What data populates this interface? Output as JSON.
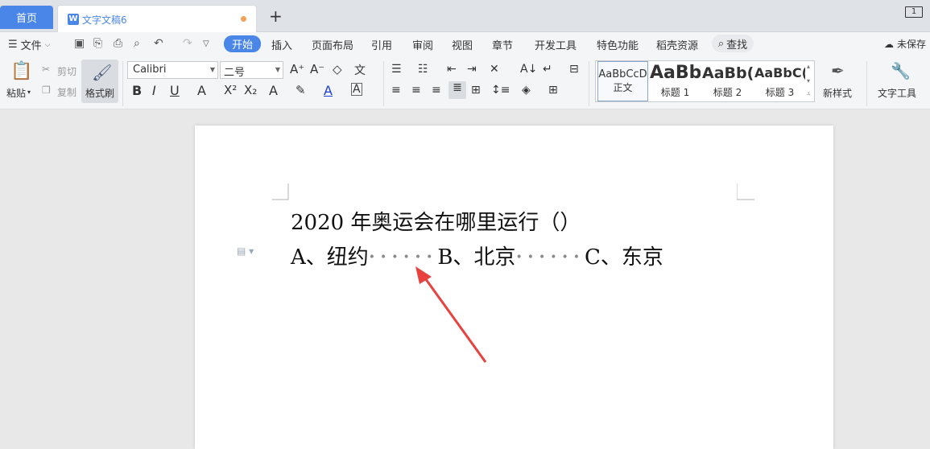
{
  "tabs": {
    "home": "首页",
    "document": "文字文稿6",
    "add": "+",
    "window_count": "1"
  },
  "menu": {
    "file": "文件",
    "items": [
      "开始",
      "插入",
      "页面布局",
      "引用",
      "审阅",
      "视图",
      "章节",
      "开发工具",
      "特色功能",
      "稻壳资源"
    ],
    "search": "查找",
    "unsaved": "未保存"
  },
  "ribbon": {
    "paste": "粘贴",
    "cut": "剪切",
    "copy": "复制",
    "format_painter": "格式刷",
    "font_name": "Calibri",
    "font_size": "二号",
    "styles": [
      {
        "sample": "AaBbCcD",
        "name": "正文"
      },
      {
        "sample": "AaBb",
        "name": "标题 1"
      },
      {
        "sample": "AaBb(",
        "name": "标题 2"
      },
      {
        "sample": "AaBbC(",
        "name": "标题 3"
      }
    ],
    "new_style": "新样式",
    "text_tools": "文字工具"
  },
  "document": {
    "question": "2020 年奥运会在哪里运行（）",
    "option_a": "A、纽约",
    "option_b": "B、北京",
    "option_c": "C、东京",
    "dots": "••••••"
  },
  "colors": {
    "accent": "#4a86e8",
    "arrow": "#e8423f",
    "unsaved_dot": "#f5a15a"
  }
}
